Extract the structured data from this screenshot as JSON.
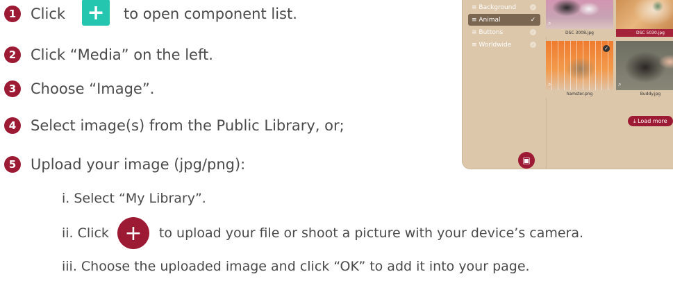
{
  "steps": [
    {
      "num": "1",
      "before": "Click",
      "after": "to open component list."
    },
    {
      "num": "2",
      "text": "Click “Media” on the left."
    },
    {
      "num": "3",
      "text": "Choose “Image”."
    },
    {
      "num": "4",
      "text": "Select image(s) from the Public Library, or;"
    },
    {
      "num": "5",
      "text": "Upload your image (jpg/png):"
    }
  ],
  "substeps": [
    {
      "text": "i.  Select “My Library”."
    },
    {
      "before": "ii. Click",
      "after": "to upload your file or shoot a picture with your device’s camera."
    },
    {
      "text": "iii. Choose the uploaded image and click “OK” to add it into your page."
    }
  ],
  "icons": {
    "plus": "+"
  },
  "panel": {
    "categories": [
      {
        "label": "≡ Background",
        "check": "✓",
        "active": false
      },
      {
        "label": "≡ Animal",
        "check": "✓",
        "active": true
      },
      {
        "label": "≡ Buttons",
        "check": "✓",
        "active": false
      },
      {
        "label": "≡ Worldwide",
        "check": "✓",
        "active": false
      }
    ],
    "images": [
      {
        "label": "DSC 3008.jpg",
        "selected": false
      },
      {
        "label": "DSC 5030.jpg",
        "selected": true
      },
      {
        "label": "hamster.png",
        "selected": false
      },
      {
        "label": "Buddy.jpg",
        "selected": false
      }
    ],
    "load_more": "⤓ Load more",
    "folder_icon": "▣",
    "zoom_icon": "⌕",
    "check_mark": "✓"
  },
  "colors": {
    "brand_red": "#9d1a34",
    "teal": "#24c6b0",
    "panel_bg": "#dcc7ab"
  }
}
